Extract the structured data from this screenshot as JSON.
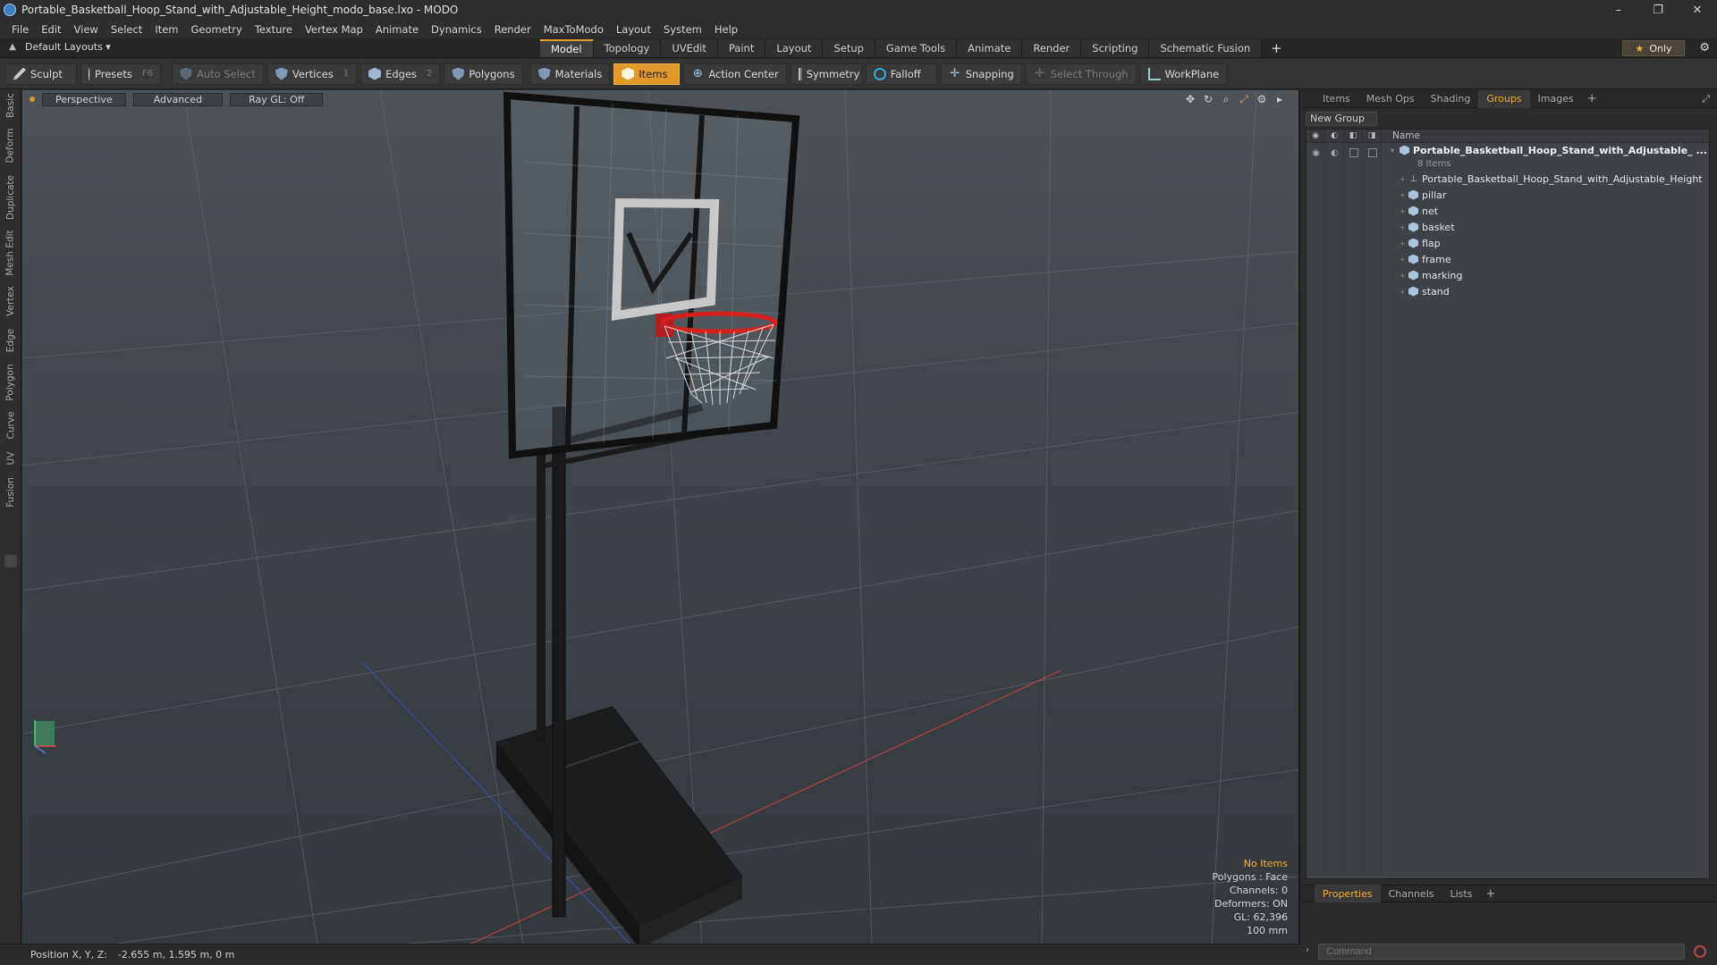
{
  "window": {
    "title": "Portable_Basketball_Hoop_Stand_with_Adjustable_Height_modo_base.lxo - MODO",
    "controls": [
      "–",
      "❐",
      "✕"
    ]
  },
  "menu": [
    "File",
    "Edit",
    "View",
    "Select",
    "Item",
    "Geometry",
    "Texture",
    "Vertex Map",
    "Animate",
    "Dynamics",
    "Render",
    "MaxToModo",
    "Layout",
    "System",
    "Help"
  ],
  "layoutbar": {
    "layouts_label": "Default Layouts ▾",
    "tabs": [
      "Model",
      "Topology",
      "UVEdit",
      "Paint",
      "Layout",
      "Setup",
      "Game Tools",
      "Animate",
      "Render",
      "Scripting",
      "Schematic Fusion"
    ],
    "active_tab": "Model",
    "plus": "+",
    "only_label": "Only",
    "star": "★",
    "gear": "⚙"
  },
  "toolbar": {
    "sculpt": "Sculpt",
    "presets": "Presets",
    "presets_key": "F6",
    "auto_select": "Auto Select",
    "vertices": "Vertices",
    "vertices_key": "1",
    "edges": "Edges",
    "edges_key": "2",
    "polygons": "Polygons",
    "materials": "Materials",
    "items": "Items",
    "action_center": "Action Center",
    "symmetry": "Symmetry",
    "falloff": "Falloff",
    "snapping": "Snapping",
    "select_through": "Select Through",
    "workplane": "WorkPlane"
  },
  "left_tabs": [
    "Basic",
    "Deform",
    "Duplicate",
    "Mesh Edit",
    "Vertex",
    "Edge",
    "Polygon",
    "Curve",
    "UV",
    "Fusion"
  ],
  "viewport": {
    "perspective": "Perspective",
    "advanced": "Advanced",
    "raygl": "Ray GL: Off",
    "info": {
      "no_items": "No Items",
      "polygons": "Polygons : Face",
      "channels": "Channels: 0",
      "deformers": "Deformers: ON",
      "gl": "GL: 62,396",
      "unit": "100 mm"
    }
  },
  "right_panel": {
    "tabs": [
      "Items",
      "Mesh Ops",
      "Shading",
      "Groups",
      "Images"
    ],
    "active_tab": "Groups",
    "new_group": "New Group",
    "name_header": "Name",
    "group_name": "Portable_Basketball_Hoop_Stand_with_Adjustable_ ...",
    "group_count": "8 Items",
    "items": [
      {
        "name": "Portable_Basketball_Hoop_Stand_with_Adjustable_Height",
        "icon": "locator-icon"
      },
      {
        "name": "pillar",
        "icon": "mesh-icon"
      },
      {
        "name": "net",
        "icon": "mesh-icon"
      },
      {
        "name": "basket",
        "icon": "mesh-icon"
      },
      {
        "name": "flap",
        "icon": "mesh-icon"
      },
      {
        "name": "frame",
        "icon": "mesh-icon"
      },
      {
        "name": "marking",
        "icon": "mesh-icon"
      },
      {
        "name": "stand",
        "icon": "mesh-icon"
      }
    ],
    "props_tabs": [
      "Properties",
      "Channels",
      "Lists"
    ],
    "props_active": "Properties",
    "command_placeholder": "Command"
  },
  "statusbar": {
    "position_label": "Position X, Y, Z:",
    "position_value": "-2.655 m, 1.595 m, 0 m"
  },
  "colors": {
    "accent": "#e39a2d",
    "rim": "#d62020",
    "active_tab_text": "#f1ad3a"
  }
}
